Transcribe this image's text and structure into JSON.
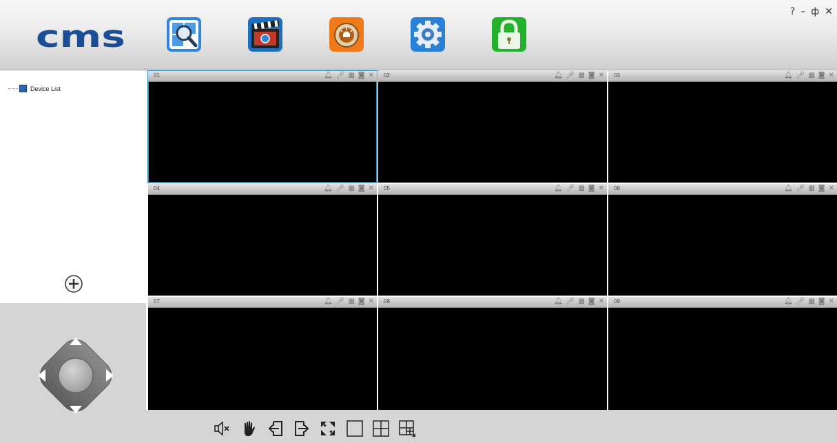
{
  "header": {
    "logo_text": "cms",
    "nav_buttons": [
      {
        "name": "search-device",
        "icon": "search-magnifier-icon"
      },
      {
        "name": "playback",
        "icon": "clapperboard-icon"
      },
      {
        "name": "alarm",
        "icon": "alarm-light-icon"
      },
      {
        "name": "settings",
        "icon": "gear-icon"
      },
      {
        "name": "lock",
        "icon": "padlock-icon"
      }
    ],
    "window_controls": {
      "help": "?",
      "minimize": "–",
      "restore": "ф",
      "close": "✕"
    }
  },
  "sidebar": {
    "tree_root_label": "Device List",
    "add_button": "+"
  },
  "grid": {
    "cells": [
      {
        "num": "01",
        "selected": true
      },
      {
        "num": "02",
        "selected": false
      },
      {
        "num": "03",
        "selected": false
      },
      {
        "num": "04",
        "selected": false
      },
      {
        "num": "05",
        "selected": false
      },
      {
        "num": "06",
        "selected": false
      },
      {
        "num": "07",
        "selected": false
      },
      {
        "num": "08",
        "selected": false
      },
      {
        "num": "09",
        "selected": false
      }
    ],
    "cell_icons": [
      "alarm-bell-icon",
      "microphone-icon",
      "record-icon",
      "snapshot-camera-icon",
      "close-icon"
    ]
  },
  "toolbar": {
    "buttons": [
      "mute-icon",
      "stop-all-icon",
      "previous-page-icon",
      "next-page-icon",
      "fullscreen-icon",
      "single-view-icon",
      "quad-view-icon",
      "multi-view-menu-icon"
    ]
  },
  "colors": {
    "accent_selected": "#3b8dc6",
    "logo_blue": "#1b4e95",
    "panel_gray": "#d4d5d7"
  }
}
